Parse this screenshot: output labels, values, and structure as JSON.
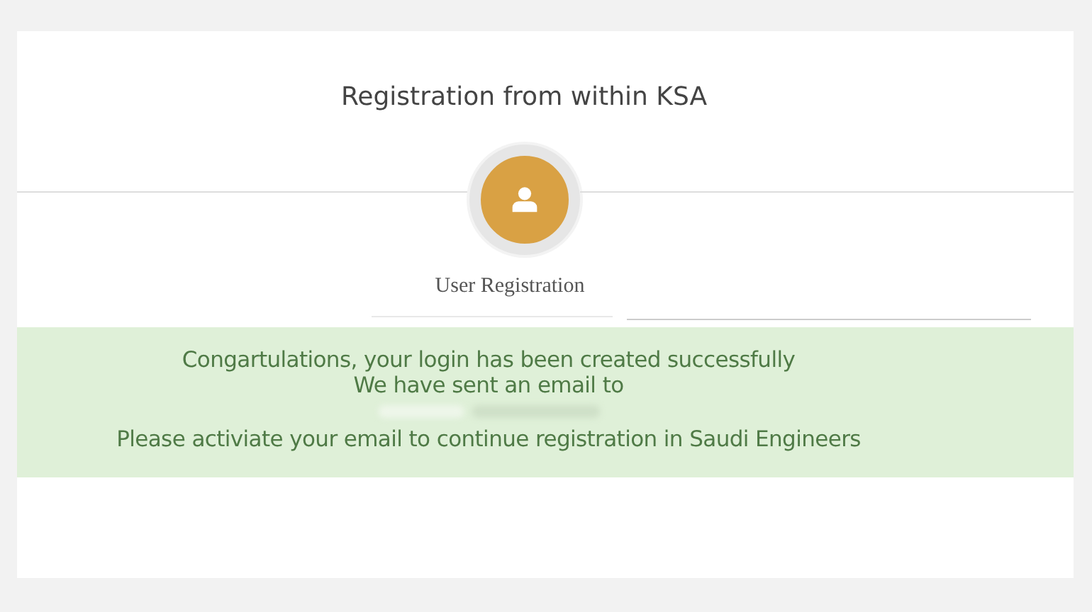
{
  "page_title": "Registration from within KSA",
  "step": {
    "label": "User Registration",
    "selected": true
  },
  "alert": {
    "lines": [
      "Congartulations, your login has been created successfully",
      "We have sent an email to",
      "Please activiate your email to continue registration in Saudi Engineers"
    ]
  }
}
